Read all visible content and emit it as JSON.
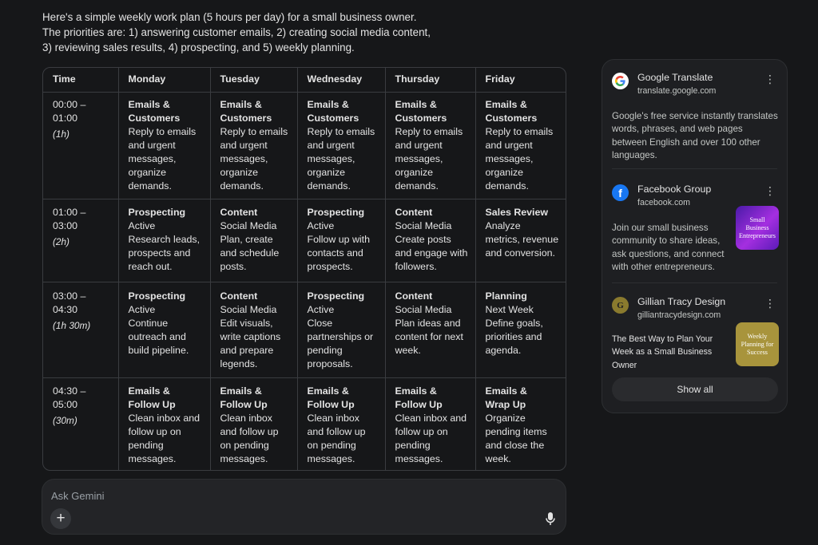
{
  "intro": {
    "line1": "Here's a simple weekly work plan (5 hours per day) for a small business owner.",
    "line2": "The priorities are: 1) answering customer emails, 2) creating social media content,",
    "line3": "3) reviewing sales results, 4) prospecting, and 5) weekly planning."
  },
  "table": {
    "headers": [
      "Time",
      "Monday",
      "Tuesday",
      "Wednesday",
      "Thursday",
      "Friday"
    ],
    "rows": [
      {
        "time": "00:00 – 01:00",
        "duration": "(1h)",
        "cells": [
          {
            "title1": "Emails &",
            "title2": "Customers",
            "desc": "Reply to emails and urgent messages, organize demands."
          },
          {
            "title1": "Emails &",
            "title2": "Customers",
            "desc": "Reply to emails and urgent messages, organize demands."
          },
          {
            "title1": "Emails &",
            "title2": "Customers",
            "desc": "Reply to emails and urgent messages, organize demands."
          },
          {
            "title1": "Emails &",
            "title2": "Customers",
            "desc": "Reply to emails and urgent messages, organize demands."
          },
          {
            "title1": "Emails &",
            "title2": "Customers",
            "desc": "Reply to emails and urgent messages, organize demands."
          }
        ]
      },
      {
        "time": "01:00 – 03:00",
        "duration": "(2h)",
        "cells": [
          {
            "title1": "Prospecting",
            "sub": "Active",
            "desc": "Research leads, prospects and reach out."
          },
          {
            "title1": "Content",
            "sub": "Social Media",
            "desc": "Plan, create and schedule posts."
          },
          {
            "title1": "Prospecting",
            "sub": "Active",
            "desc": "Follow up with contacts and prospects."
          },
          {
            "title1": "Content",
            "sub": "Social Media",
            "desc": "Create posts and engage with followers."
          },
          {
            "title1": "Sales Review",
            "sub": "Analyze",
            "desc": "metrics, revenue and conversion."
          }
        ]
      },
      {
        "time": "03:00 – 04:30",
        "duration": "(1h 30m)",
        "cells": [
          {
            "title1": "Prospecting",
            "sub": "Active",
            "desc": "Continue outreach and build pipeline."
          },
          {
            "title1": "Content",
            "sub": "Social Media",
            "desc": "Edit visuals, write captions and prepare legends."
          },
          {
            "title1": "Prospecting",
            "sub": "Active",
            "desc": "Close partnerships or pending proposals."
          },
          {
            "title1": "Content",
            "sub": "Social Media",
            "desc": "Plan ideas and content for next week."
          },
          {
            "title1": "Planning",
            "sub": "Next Week",
            "desc": "Define goals, priorities and agenda."
          }
        ]
      },
      {
        "time": "04:30 – 05:00",
        "duration": "(30m)",
        "cells": [
          {
            "title1": "Emails &",
            "title2": "Follow Up",
            "desc": "Clean inbox and follow up on pending messages."
          },
          {
            "title1": "Emails &",
            "title2": "Follow Up",
            "desc": "Clean inbox and follow up on pending messages."
          },
          {
            "title1": "Emails &",
            "title2": "Follow Up",
            "desc": "Clean inbox and follow up on pending messages."
          },
          {
            "title1": "Emails &",
            "title2": "Follow Up",
            "desc": "Clean inbox and follow up on pending messages."
          },
          {
            "title1": "Emails &",
            "title2": "Wrap Up",
            "desc": "Organize pending items and close the week."
          }
        ]
      }
    ]
  },
  "ask": {
    "placeholder": "Ask Gemini",
    "plus": "+"
  },
  "sources": {
    "items": [
      {
        "name": "Google Translate",
        "url": "translate.google.com",
        "icon": "google-icon",
        "text": "Google's free service instantly translates words, phrases, and web pages between English and over 100 other languages."
      },
      {
        "name": "Facebook Group",
        "url": "facebook.com",
        "icon": "facebook-icon",
        "text": "Join our small business community to share ideas, ask questions, and connect with other entrepreneurs.",
        "thumb": "Small Business Entrepreneurs"
      },
      {
        "name": "Gillian Tracy Design",
        "url": "gilliantracydesign.com",
        "icon": "g-letter-icon",
        "letter": "G",
        "text": "The Best Way to Plan Your Week as a Small Business Owner",
        "thumb": "Weekly Planning for Success"
      }
    ],
    "show_all": "Show all"
  },
  "colors": {
    "background": "#161719",
    "panel": "#1e1f22",
    "facebook": "#1877f2",
    "gillian": "#8a7a2e",
    "thumb_gold": "#a8943c",
    "thumb_purple": "#7a2bd9"
  }
}
